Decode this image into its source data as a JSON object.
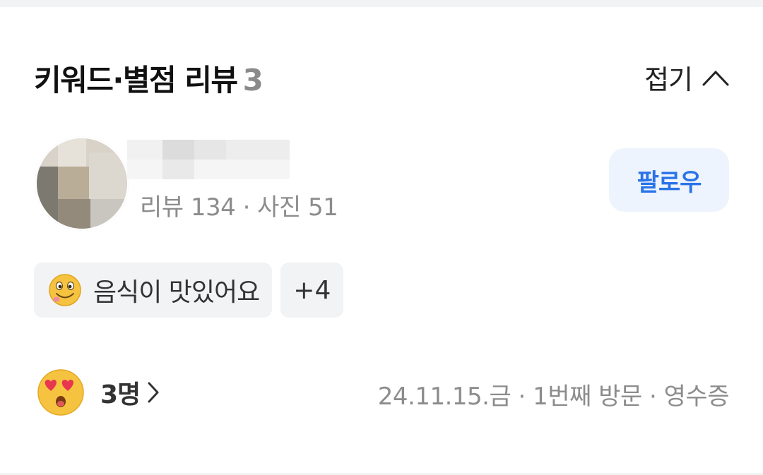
{
  "header": {
    "title": "키워드·별점 리뷰",
    "count": "3",
    "fold_label": "접기"
  },
  "reviewer": {
    "meta": "리뷰 134 · 사진 51",
    "follow_label": "팔로우"
  },
  "keywords": {
    "first_chip": "음식이 맛있어요",
    "more_label": "+4"
  },
  "footer": {
    "reaction_count": "3명",
    "visit_info": "24.11.15.금 · 1번째 방문 · 영수증"
  },
  "colors": {
    "accent": "#2a73e8",
    "follow_bg": "#eef4fd",
    "chip_bg": "#f2f3f5",
    "meta_text": "#8c8c8c"
  },
  "icons": [
    "chevron-up-icon",
    "yum-face-emoji-icon",
    "heart-eyes-emoji-icon",
    "chevron-right-icon"
  ]
}
